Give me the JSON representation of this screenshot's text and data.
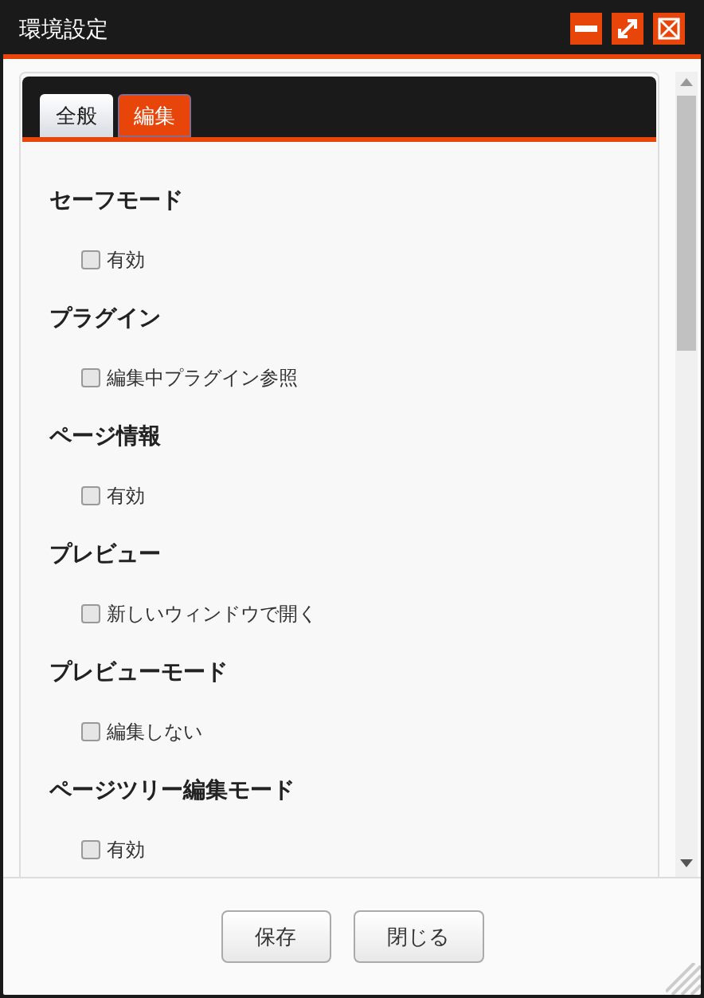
{
  "window": {
    "title": "環境設定"
  },
  "tabs": [
    {
      "label": "全般",
      "selected": false
    },
    {
      "label": "編集",
      "selected": true
    }
  ],
  "sections": [
    {
      "heading": "セーフモード",
      "option": {
        "label": "有効",
        "checked": false
      }
    },
    {
      "heading": "プラグイン",
      "option": {
        "label": "編集中プラグイン参照",
        "checked": false
      }
    },
    {
      "heading": "ページ情報",
      "option": {
        "label": "有効",
        "checked": false
      }
    },
    {
      "heading": "プレビュー",
      "option": {
        "label": "新しいウィンドウで開く",
        "checked": false
      }
    },
    {
      "heading": "プレビューモード",
      "option": {
        "label": "編集しない",
        "checked": false
      }
    },
    {
      "heading": "ページツリー編集モード",
      "option": {
        "label": "有効",
        "checked": false
      }
    }
  ],
  "buttons": [
    "保存",
    "閉じる"
  ]
}
